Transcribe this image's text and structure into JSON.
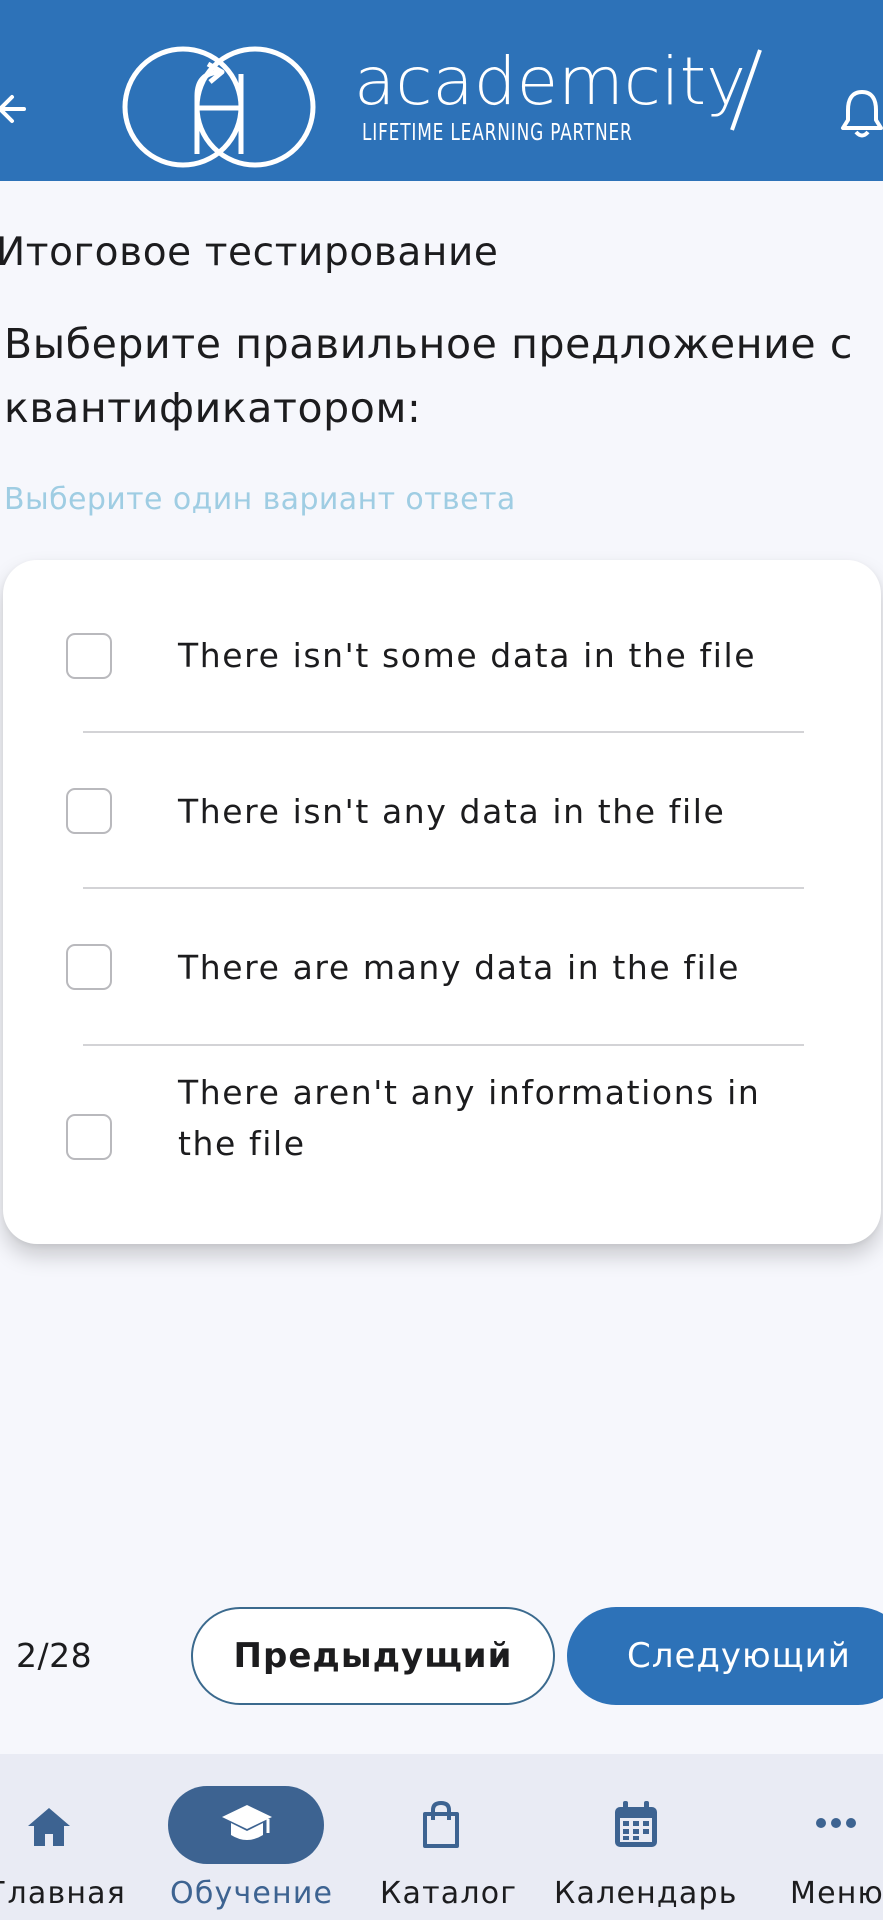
{
  "header": {
    "logo_word": "academcity",
    "logo_tagline": "LIFETIME LEARNING PARTNER",
    "brand_color": "#2d72b8"
  },
  "page": {
    "title": "Итоговое тестирование",
    "question": "Выберите правильное предложение с квантификатором:",
    "hint": "Выберите один вариант ответа"
  },
  "options": [
    {
      "label": "There isn't some data in the file",
      "checked": false
    },
    {
      "label": "There isn't any data in the file",
      "checked": false
    },
    {
      "label": "There are many data in the file",
      "checked": false
    },
    {
      "label": "There aren't any informations in the file",
      "checked": false
    }
  ],
  "pagination": {
    "counter": "2/28",
    "prev_label": "Предыдущий",
    "next_label": "Следующий"
  },
  "nav": {
    "items": [
      {
        "label": "Главная",
        "icon": "home-icon",
        "active": false
      },
      {
        "label": "Обучение",
        "icon": "graduation-cap-icon",
        "active": true
      },
      {
        "label": "Каталог",
        "icon": "shopping-bag-icon",
        "active": false
      },
      {
        "label": "Календарь",
        "icon": "calendar-icon",
        "active": false
      },
      {
        "label": "Меню",
        "icon": "more-dots-icon",
        "active": false
      }
    ],
    "active_color": "#3d6391"
  }
}
